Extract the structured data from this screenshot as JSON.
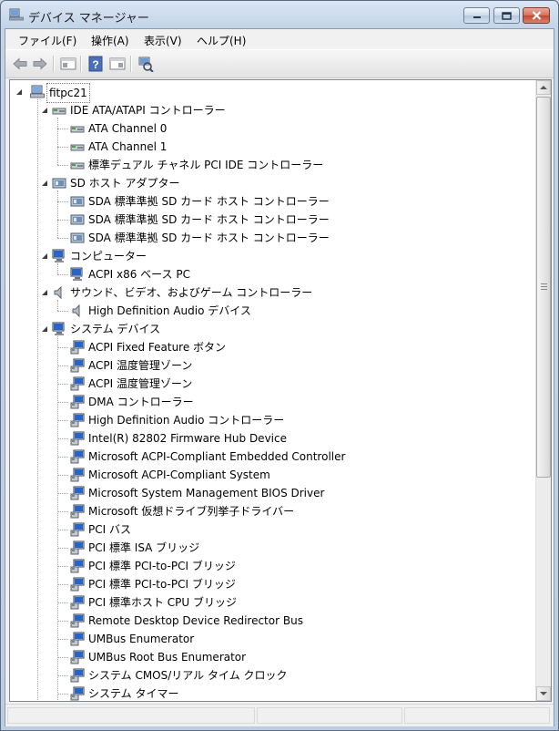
{
  "window": {
    "title": "デバイス マネージャー"
  },
  "menu": [
    {
      "label": "ファイル(F)"
    },
    {
      "label": "操作(A)"
    },
    {
      "label": "表示(V)"
    },
    {
      "label": "ヘルプ(H)"
    }
  ],
  "toolbar": {
    "buttons": [
      "back-arrow-icon",
      "forward-arrow-icon",
      "properties-icon",
      "help-icon",
      "view-icon",
      "scan-hardware-icon"
    ]
  },
  "tree": {
    "root": {
      "label": "fitpc21",
      "icon": "computer-icon"
    },
    "rows": [
      {
        "label": "IDE ATA/ATAPI コントローラー",
        "level": 1,
        "expanded": true,
        "icon": "ide-controller-icon"
      },
      {
        "label": "ATA Channel 0",
        "level": 2,
        "icon": "ide-controller-icon"
      },
      {
        "label": "ATA Channel 1",
        "level": 2,
        "icon": "ide-controller-icon"
      },
      {
        "label": "標準デュアル チャネル PCI IDE コントローラー",
        "level": 2,
        "icon": "ide-controller-icon"
      },
      {
        "label": "SD ホスト アダプター",
        "level": 1,
        "expanded": true,
        "icon": "sd-host-icon"
      },
      {
        "label": "SDA 標準準拠 SD カード ホスト コントローラー",
        "level": 2,
        "icon": "sd-host-icon"
      },
      {
        "label": "SDA 標準準拠 SD カード ホスト コントローラー",
        "level": 2,
        "icon": "sd-host-icon"
      },
      {
        "label": "SDA 標準準拠 SD カード ホスト コントローラー",
        "level": 2,
        "icon": "sd-host-icon"
      },
      {
        "label": "コンピューター",
        "level": 1,
        "expanded": true,
        "icon": "monitor-icon"
      },
      {
        "label": "ACPI x86 ベース PC",
        "level": 2,
        "icon": "monitor-icon"
      },
      {
        "label": "サウンド、ビデオ、およびゲーム コントローラー",
        "level": 1,
        "expanded": true,
        "icon": "speaker-icon"
      },
      {
        "label": "High Definition Audio デバイス",
        "level": 2,
        "icon": "speaker-icon"
      },
      {
        "label": "システム デバイス",
        "level": 1,
        "expanded": true,
        "icon": "monitor-icon"
      },
      {
        "label": "ACPI Fixed Feature ボタン",
        "level": 2,
        "icon": "system-device-icon"
      },
      {
        "label": "ACPI 温度管理ゾーン",
        "level": 2,
        "icon": "system-device-icon"
      },
      {
        "label": "ACPI 温度管理ゾーン",
        "level": 2,
        "icon": "system-device-icon"
      },
      {
        "label": "DMA コントローラー",
        "level": 2,
        "icon": "system-device-icon"
      },
      {
        "label": "High Definition Audio コントローラー",
        "level": 2,
        "icon": "system-device-icon"
      },
      {
        "label": "Intel(R) 82802 Firmware Hub Device",
        "level": 2,
        "icon": "system-device-icon"
      },
      {
        "label": "Microsoft ACPI-Compliant Embedded Controller",
        "level": 2,
        "icon": "system-device-icon"
      },
      {
        "label": "Microsoft ACPI-Compliant System",
        "level": 2,
        "icon": "system-device-icon"
      },
      {
        "label": "Microsoft System Management BIOS Driver",
        "level": 2,
        "icon": "system-device-icon"
      },
      {
        "label": "Microsoft 仮想ドライブ列挙子ドライバー",
        "level": 2,
        "icon": "system-device-icon"
      },
      {
        "label": "PCI バス",
        "level": 2,
        "icon": "system-device-icon"
      },
      {
        "label": "PCI 標準 ISA ブリッジ",
        "level": 2,
        "icon": "system-device-icon"
      },
      {
        "label": "PCI 標準 PCI-to-PCI ブリッジ",
        "level": 2,
        "icon": "system-device-icon"
      },
      {
        "label": "PCI 標準 PCI-to-PCI ブリッジ",
        "level": 2,
        "icon": "system-device-icon"
      },
      {
        "label": "PCI 標準ホスト CPU ブリッジ",
        "level": 2,
        "icon": "system-device-icon"
      },
      {
        "label": "Remote Desktop Device Redirector Bus",
        "level": 2,
        "icon": "system-device-icon"
      },
      {
        "label": "UMBus Enumerator",
        "level": 2,
        "icon": "system-device-icon"
      },
      {
        "label": "UMBus Root Bus Enumerator",
        "level": 2,
        "icon": "system-device-icon"
      },
      {
        "label": "システム CMOS/リアル タイム クロック",
        "level": 2,
        "icon": "system-device-icon"
      },
      {
        "label": "システム タイマー",
        "level": 2,
        "icon": "system-device-icon"
      }
    ]
  },
  "colors": {
    "titlebar": "#c3d4e8",
    "tree_background": "#ffffff",
    "close_button": "#c2472f"
  }
}
